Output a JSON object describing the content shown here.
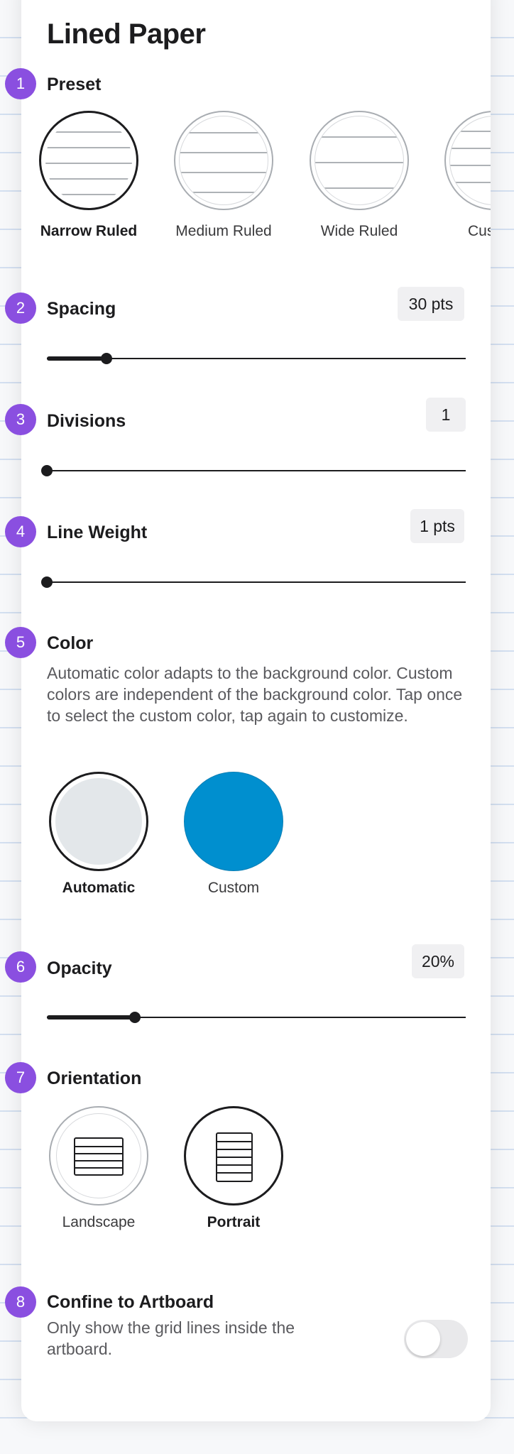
{
  "title": "Lined Paper",
  "sections": {
    "preset": {
      "number": "1",
      "label": "Preset",
      "options": [
        {
          "label": "Narrow Ruled",
          "selected": true
        },
        {
          "label": "Medium Ruled",
          "selected": false
        },
        {
          "label": "Wide Ruled",
          "selected": false
        },
        {
          "label": "Cus",
          "selected": false
        }
      ]
    },
    "spacing": {
      "number": "2",
      "label": "Spacing",
      "value": "30 pts",
      "slider_fraction": 0.14
    },
    "divisions": {
      "number": "3",
      "label": "Divisions",
      "value": "1",
      "slider_fraction": 0.0
    },
    "line_weight": {
      "number": "4",
      "label": "Line Weight",
      "value": "1 pts",
      "slider_fraction": 0.0
    },
    "color": {
      "number": "5",
      "label": "Color",
      "description": "Automatic color adapts to the background color. Custom colors are independent of the background color. Tap once to select the custom color, tap again to customize.",
      "options": [
        {
          "label": "Automatic",
          "swatch": "#e3e7ea",
          "selected": true
        },
        {
          "label": "Custom",
          "swatch": "#008fcf",
          "selected": false
        }
      ]
    },
    "opacity": {
      "number": "6",
      "label": "Opacity",
      "value": "20%",
      "slider_fraction": 0.21
    },
    "orientation": {
      "number": "7",
      "label": "Orientation",
      "options": [
        {
          "label": "Landscape",
          "selected": false
        },
        {
          "label": "Portrait",
          "selected": true
        }
      ]
    },
    "confine": {
      "number": "8",
      "label": "Confine to Artboard",
      "description": "Only show the grid lines inside the artboard.",
      "enabled": false
    }
  },
  "colors": {
    "accent_badge": "#8a4fe0",
    "control": "#1c1c1e"
  }
}
